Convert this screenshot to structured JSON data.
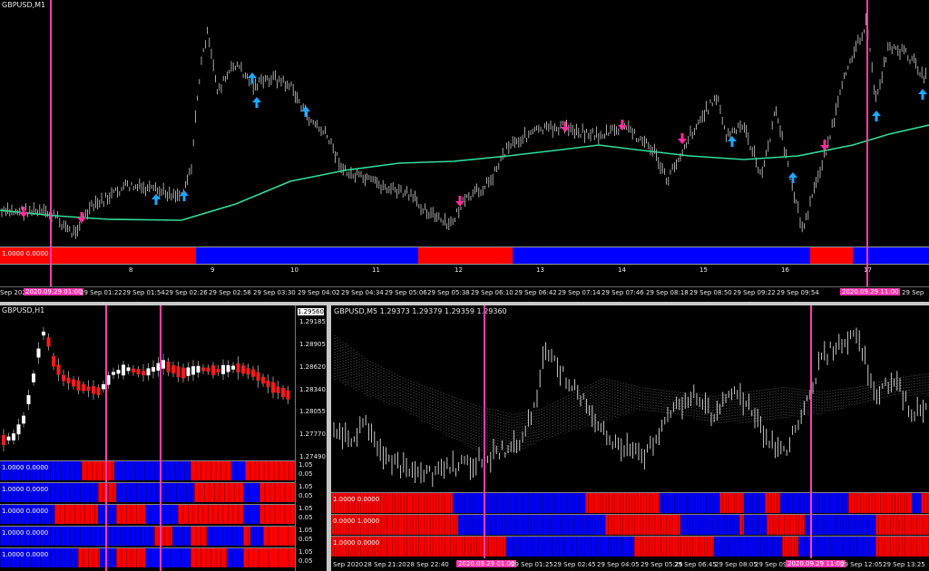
{
  "top": {
    "title": "GBPUSD,M1",
    "bar_label": "1.0000 0.0000",
    "axis_numbers": [
      "8",
      "9",
      "10",
      "11",
      "12",
      "13",
      "14",
      "15",
      "16",
      "17"
    ],
    "time_labels": [
      "Sep 2020",
      "29 Sep 01:22",
      "29 Sep 01:54",
      "29 Sep 02:26",
      "29 Sep 02:58",
      "29 Sep 03:30",
      "29 Sep 04:02",
      "29 Sep 04:34",
      "29 Sep 05:06",
      "29 Sep 05:38",
      "29 Sep 06:10",
      "29 Sep 06:42",
      "29 Sep 07:14",
      "29 Sep 07:46",
      "29 Sep 08:18",
      "29 Sep 08:50",
      "29 Sep 09:22",
      "29 Sep 09:54",
      "29 Sep"
    ],
    "tag_left": "2020.09.29 01:00",
    "tag_right": "2020.09.29 11:00",
    "colors": {
      "ma": "#33dd99",
      "up_arrow": "#1ea7ff",
      "down_arrow": "#ff2d9a",
      "vline": "#ff3fa8",
      "bar_red": "#ff0000",
      "bar_blue": "#0000ff"
    }
  },
  "bottom_left": {
    "title": "GBPUSD,H1",
    "price_labels": [
      "1.29185",
      "1.28905",
      "1.28620",
      "1.28340",
      "1.28055",
      "1.27770",
      "1.27490"
    ],
    "top_price": "1.29560",
    "rows": [
      {
        "label": "1.0000 0.0000",
        "scale": [
          "1.05",
          "0.05"
        ]
      },
      {
        "label": "1.0000 0.0000",
        "scale": [
          "1.05",
          "0.05"
        ]
      },
      {
        "label": "1.0000 0.0000",
        "scale": [
          "1.05",
          "0.05"
        ]
      },
      {
        "label": "1.0000 0.0000",
        "scale": [
          "1.05",
          "0.05"
        ]
      },
      {
        "label": "1.0000 0.0000",
        "scale": [
          "1.05",
          "0.05"
        ]
      }
    ]
  },
  "bottom_right": {
    "title": "GBPUSD,M5  1.29373 1.29379 1.29359 1.29360",
    "rows": [
      {
        "label": "1.0000 0.0000"
      },
      {
        "label": "0.0000 1.0000"
      },
      {
        "label": "1.0000 0.0000"
      }
    ],
    "time_labels": [
      "Sep 2020",
      "28 Sep 21:20",
      "28 Sep 22:40",
      "29 Sep 01:25",
      "29 Sep 02:45",
      "29 Sep 04:05",
      "29 Sep 05:25",
      "29 Sep 06:45",
      "29 Sep 08:05",
      "29 Sep 09:25",
      "29 Sep 12:05",
      "29 Sep 13:25"
    ],
    "tag_left": "2020.09.29 01:00",
    "tag_right": "2020.09.29 11:00"
  }
}
